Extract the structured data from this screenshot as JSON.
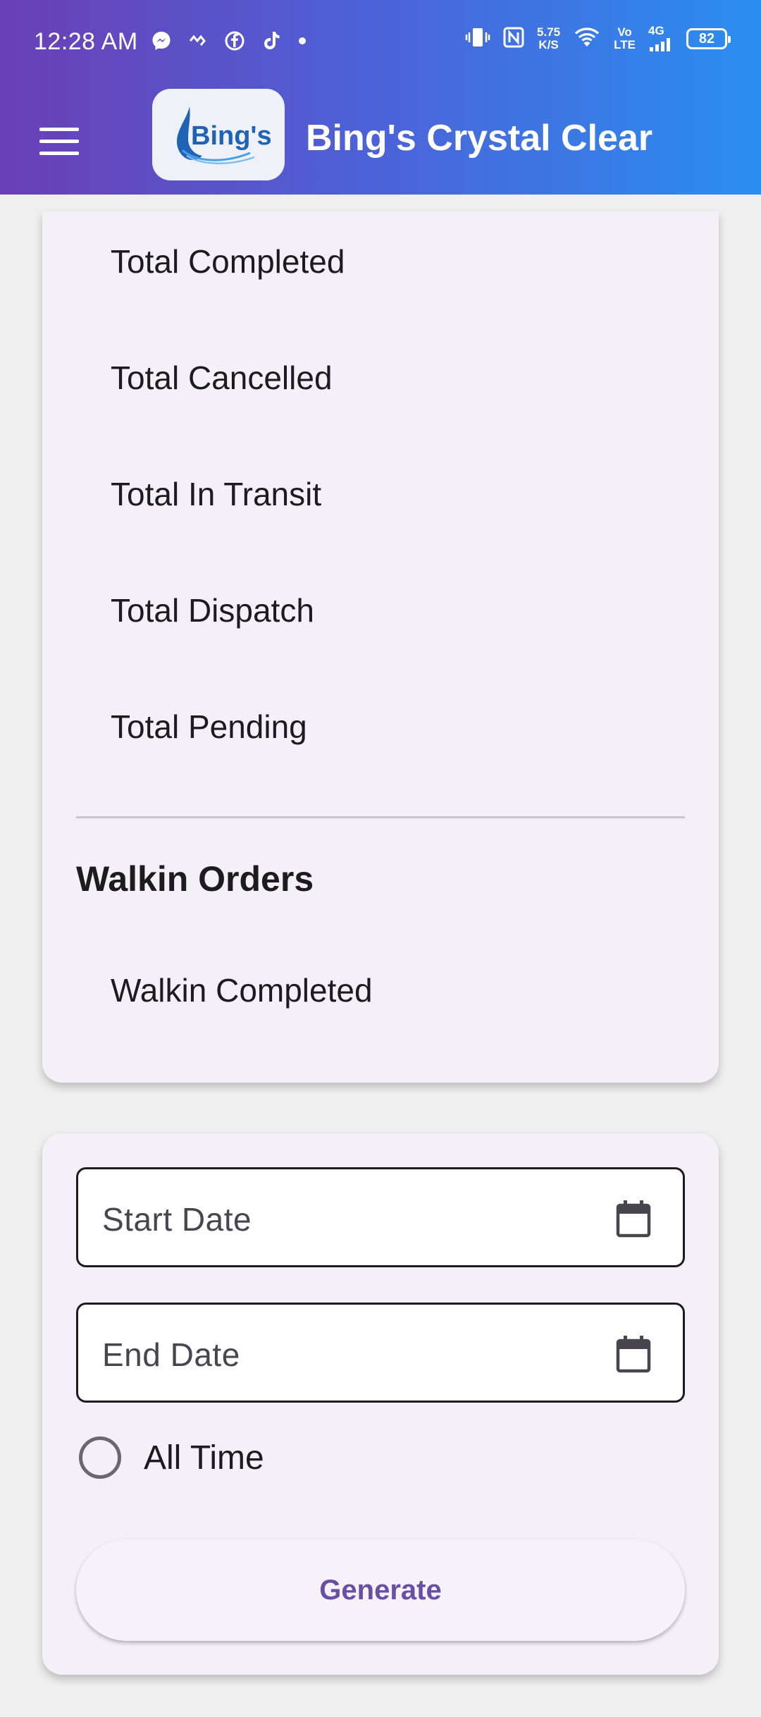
{
  "status_bar": {
    "time": "12:28 AM",
    "net_speed_value": "5.75",
    "net_speed_unit": "K/S",
    "volte_top": "Vo",
    "volte_bottom": "LTE",
    "network_type": "4G",
    "battery": "82",
    "notification_icons": [
      "messenger-icon",
      "link-icon",
      "facebook-icon",
      "tiktok-icon",
      "dot-icon"
    ]
  },
  "app_bar": {
    "title": "Bing's Crystal Clear",
    "logo_text": "Bing's",
    "colors": {
      "gradient_start": "#6b3fb5",
      "gradient_end": "#2a8ef0"
    }
  },
  "stats_card": {
    "items": [
      "Total Completed",
      "Total Cancelled",
      "Total In Transit",
      "Total Dispatch",
      "Total Pending"
    ],
    "walkin_title": "Walkin Orders",
    "walkin_items": [
      "Walkin Completed"
    ]
  },
  "report_form": {
    "start_date_placeholder": "Start Date",
    "end_date_placeholder": "End Date",
    "all_time_label": "All Time",
    "generate_label": "Generate",
    "accent_color": "#6750a4"
  }
}
